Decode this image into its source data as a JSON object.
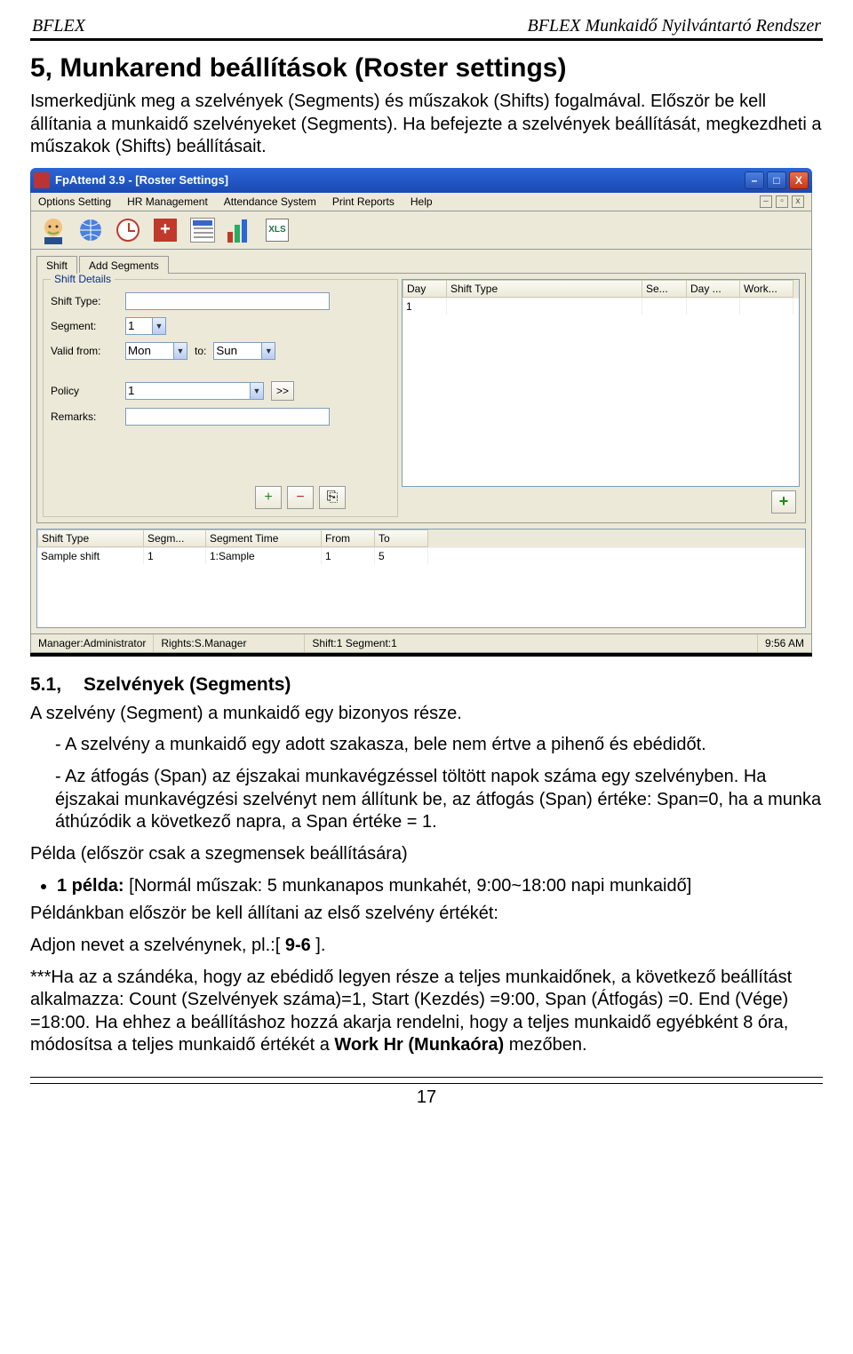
{
  "header": {
    "left": "BFLEX",
    "right": "BFLEX Munkaidő Nyilvántartó Rendszer"
  },
  "heading": "5, Munkarend beállítások (Roster settings)",
  "intro": "Ismerkedjünk meg a szelvények (Segments) és műszakok (Shifts) fogalmával. Először be kell állítania a munkaidő szelvényeket (Segments). Ha befejezte a szelvények beállítását, megkezdheti a műszakok (Shifts) beállításait.",
  "window": {
    "title": "FpAttend 3.9 - [Roster Settings]",
    "menu": [
      "Options Setting",
      "HR Management",
      "Attendance System",
      "Print Reports",
      "Help"
    ],
    "sysbtns": {
      "min": "–",
      "max": "□",
      "close": "X",
      "mdi": [
        "–",
        "▫",
        "x"
      ]
    },
    "toolbarIcons": [
      "face",
      "globe",
      "clock",
      "plus",
      "calendar",
      "chart",
      "xls"
    ],
    "xlsLabel": "XLS",
    "tabs": [
      "Shift",
      "Add Segments"
    ],
    "activeTab": 0,
    "shiftDetails": {
      "legend": "Shift Details",
      "labels": {
        "shiftType": "Shift Type:",
        "segment": "Segment:",
        "validFrom": "Valid from:",
        "to": "to:",
        "policy": "Policy",
        "remarks": "Remarks:",
        "more": ">>"
      },
      "values": {
        "shiftType": "",
        "segment": "1",
        "validFrom": "Mon",
        "validTo": "Sun",
        "policy": "1",
        "remarks": ""
      }
    },
    "toolIcons": {
      "add": "+",
      "remove": "−",
      "dup": "⎘"
    },
    "grid1": {
      "cols": [
        "Day",
        "Shift Type",
        "Se...",
        "Day ...",
        "Work..."
      ],
      "widths": [
        50,
        220,
        50,
        60,
        60
      ],
      "rows": [
        [
          "1",
          "",
          "",
          "",
          ""
        ]
      ]
    },
    "addBtn": "+",
    "grid2": {
      "cols": [
        "Shift Type",
        "Segm...",
        "Segment Time",
        "From",
        "To"
      ],
      "widths": [
        120,
        70,
        130,
        60,
        60
      ],
      "rows": [
        [
          "Sample shift",
          "1",
          "1:Sample",
          "1",
          "5"
        ]
      ]
    },
    "status": {
      "manager": "Manager:Administrator",
      "rights": "Rights:S.Manager",
      "shift": "Shift:1 Segment:1",
      "time": "9:56 AM"
    }
  },
  "sub": {
    "num": "5.1,",
    "title": "Szelvények (Segments)"
  },
  "body1": "A szelvény (Segment) a munkaidő egy bizonyos része.",
  "body2": "- A szelvény a munkaidő egy adott szakasza, bele nem értve a pihenő és ebédidőt.",
  "body3": "- Az átfogás (Span) az éjszakai munkavégzéssel töltött napok száma egy szelvényben. Ha éjszakai munkavégzési szelvényt nem állítunk be, az átfogás (Span) értéke: Span=0, ha a munka áthúzódik a következő napra, a Span értéke = 1.",
  "example": {
    "lead": "Példa (először csak a szegmensek beállítására)",
    "bullet": {
      "boldLead": "1 példa:",
      "rest": " [Normál műszak: 5 munkanapos munkahét, 9:00~18:00 napi munkaidő]"
    },
    "p1": "Példánkban először be kell állítani az első szelvény értékét:",
    "p2a": "Adjon nevet a szelvénynek, pl.:[ ",
    "p2bold": "9-6",
    "p2b": " ].",
    "p3a": "***Ha az a szándéka, hogy az ebédidő legyen része a teljes munkaidőnek, a következő beállítást alkalmazza: Count (Szelvények száma)=1, Start (Kezdés) =9:00, Span (Átfogás) =0. End (Vége) =18:00. Ha ehhez a beállításhoz hozzá akarja rendelni, hogy a teljes munkaidő egyébként 8 óra, módosítsa a teljes munkaidő értékét a ",
    "p3bold": "Work Hr (Munkaóra)",
    "p3b": " mezőben."
  },
  "pageNum": "17"
}
